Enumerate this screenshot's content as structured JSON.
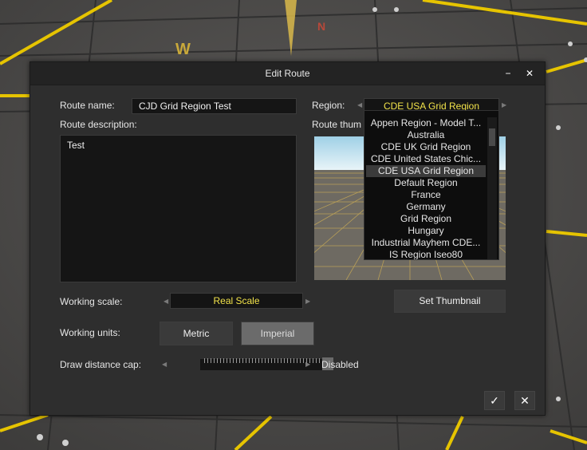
{
  "dialog": {
    "title": "Edit Route",
    "minimize_glyph": "−",
    "close_glyph": "✕"
  },
  "route": {
    "name_label": "Route name:",
    "name_value": "CJD Grid Region Test",
    "description_label": "Route description:",
    "description_value": "Test",
    "region_label": "Region:",
    "region_value": "CDE USA Grid Region",
    "thumbnail_label": "Route thum"
  },
  "region_dropdown": {
    "items": [
      "Appen Region - Model T...",
      "Australia",
      "CDE UK Grid Region",
      "CDE United States Chic...",
      "CDE USA Grid Region",
      "Default Region",
      "France",
      "Germany",
      "Grid Region",
      "Hungary",
      "Industrial Mayhem CDE...",
      "IS Region Iseo80"
    ],
    "selected": "CDE USA Grid Region"
  },
  "working_scale": {
    "label": "Working scale:",
    "value": "Real Scale"
  },
  "set_thumbnail_label": "Set Thumbnail",
  "working_units": {
    "label": "Working units:",
    "metric_label": "Metric",
    "imperial_label": "Imperial",
    "active": "Imperial"
  },
  "draw_distance": {
    "label": "Draw distance cap:",
    "value": "Disabled"
  },
  "footer": {
    "ok_glyph": "✓",
    "cancel_glyph": "✕"
  },
  "compass_letters": [
    "W",
    "N"
  ],
  "colors": {
    "accent_yellow": "#f2e34a",
    "dialog_bg": "#2e2e2e",
    "titlebar_bg": "#232323",
    "field_bg": "#151515",
    "active_button": "#6b6b6b"
  },
  "icons": {
    "minimize": "minimize-icon",
    "close": "close-icon",
    "arrow_left": "arrow-left-icon",
    "arrow_right": "arrow-right-icon",
    "ok": "checkmark-icon",
    "cancel": "close-icon"
  }
}
